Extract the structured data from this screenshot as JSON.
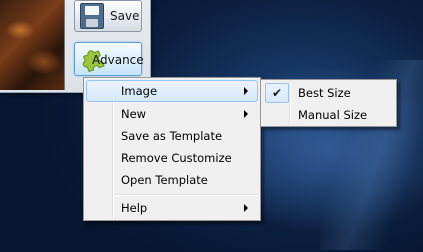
{
  "toolbar": {
    "save_label": "Save",
    "advance_label": "Advance"
  },
  "context_menu": {
    "items": [
      {
        "label": "Image",
        "has_submenu": true,
        "highlighted": true
      },
      {
        "label": "New",
        "has_submenu": true
      },
      {
        "label": "Save as Template"
      },
      {
        "label": "Remove Customize"
      },
      {
        "label": "Open Template"
      },
      {
        "label": "Help",
        "has_submenu": true
      }
    ]
  },
  "image_submenu": {
    "items": [
      {
        "label": "Best Size",
        "checked": true
      },
      {
        "label": "Manual Size",
        "checked": false
      }
    ],
    "check_glyph": "✔"
  },
  "colors": {
    "highlight_border": "#9ac3ee",
    "highlight_fill": "#d6e8fb",
    "desktop": "#0b1f3f"
  }
}
